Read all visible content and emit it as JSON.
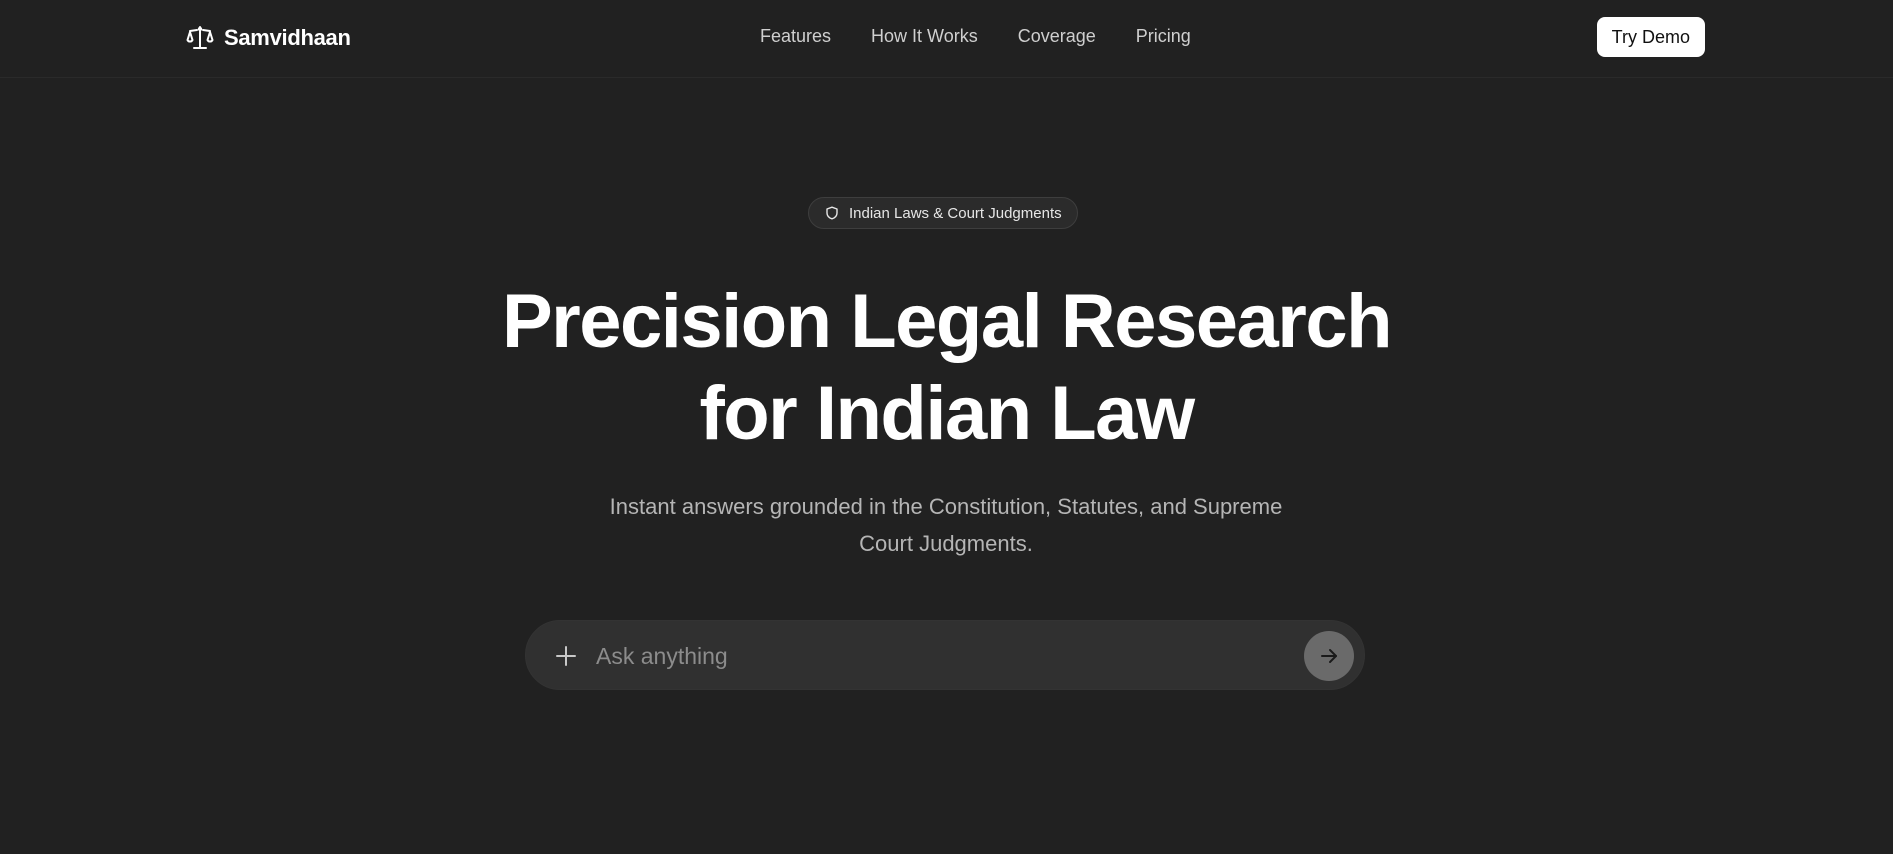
{
  "header": {
    "brand_name": "Samvidhaan",
    "brand_icon": "scales-icon",
    "nav": [
      {
        "label": "Features"
      },
      {
        "label": "How It Works"
      },
      {
        "label": "Coverage"
      },
      {
        "label": "Pricing"
      }
    ],
    "cta_label": "Try Demo"
  },
  "hero": {
    "badge_icon": "shield-icon",
    "badge_label": "Indian Laws & Court Judgments",
    "title_line1": "Precision Legal Research",
    "title_line2": "for Indian Law",
    "subtitle": "Instant answers grounded in the Constitution, Statutes, and Supreme Court Judgments."
  },
  "search": {
    "placeholder": "Ask anything",
    "value": "",
    "add_icon": "plus-icon",
    "send_icon": "arrow-right-icon"
  },
  "colors": {
    "background": "#212121",
    "accent_button": "#ffffff",
    "search_background": "#303030",
    "send_button": "#6a6a6a"
  }
}
